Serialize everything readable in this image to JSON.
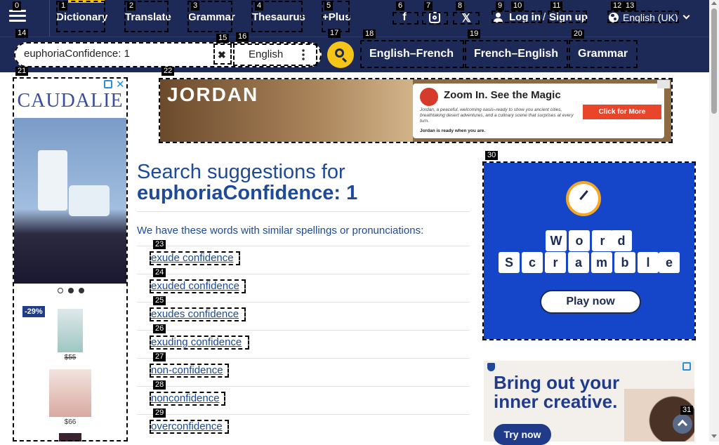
{
  "nav": {
    "items": [
      "Dictionary",
      "Translate",
      "Grammar",
      "Thesaurus",
      "+Plus"
    ],
    "login": "Log in",
    "slash": "/",
    "signup": "Sign up",
    "language": "English (UK)"
  },
  "search": {
    "value": "euphoriaConfidence: 1",
    "placeholder": "",
    "lang": "English",
    "tabs": [
      "English–French",
      "French–English",
      "Grammar"
    ]
  },
  "ads": {
    "left_brand": "CAUDALIE",
    "left_discount": "-29%",
    "left_price1": "$55",
    "left_price2": "$66",
    "top_brand": "JORDAN",
    "top_headline": "Zoom In. See the Magic",
    "top_body": "Jordan, a peaceful, welcoming oasis–ready to show you ancient cities, breathtaking desert adventures, and a culinary scene that surprises at every turn.",
    "top_tag": "Jordan is ready when you are.",
    "top_cta": "Click for More",
    "game_row1": [
      "W",
      "o",
      "r",
      "d"
    ],
    "game_row2": [
      "S",
      "c",
      "r",
      "a",
      "m",
      "b",
      "l",
      "e"
    ],
    "game_cta": "Play now",
    "bottom_headline": "Bring out your inner creative.",
    "bottom_cta": "Try now"
  },
  "results": {
    "title_prefix": "Search suggestions for",
    "title_query": "euphoriaConfidence: 1",
    "intro": "We have these words with similar spellings or pronunciations:",
    "suggestions": [
      "exude confidence",
      "exuded confidence",
      "exudes confidence",
      "exuding confidence",
      "non-confidence",
      "nonconfidence",
      "overconfidence"
    ]
  },
  "labels": [
    "0",
    "1",
    "2",
    "3",
    "4",
    "5",
    "6",
    "7",
    "8",
    "9",
    "10",
    "11",
    "12",
    "13",
    "14",
    "15",
    "16",
    "17",
    "18",
    "19",
    "20",
    "21",
    "22",
    "23",
    "24",
    "25",
    "26",
    "27",
    "28",
    "29",
    "30",
    "31"
  ],
  "colors": {
    "nav_bg": "#1d2a57",
    "accent": "#f5c518",
    "link": "#1d4a9a",
    "game_bg": "#1546c9"
  }
}
